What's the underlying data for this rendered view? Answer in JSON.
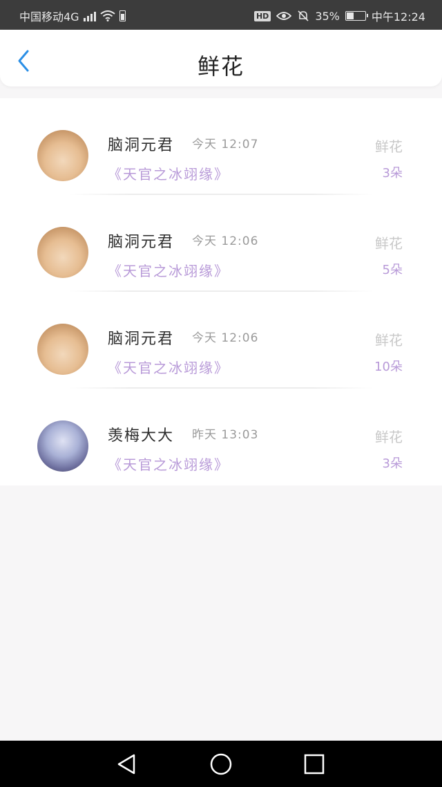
{
  "status_bar": {
    "carrier": "中国移动4G",
    "network": "4G",
    "battery_percent": "35%",
    "battery_level": 0.35,
    "time": "中午12:24",
    "hd_label": "HD"
  },
  "header": {
    "title": "鲜花",
    "back_icon": "chevron-left-icon",
    "accent_color": "#2b8fe6"
  },
  "colors": {
    "book_title": "#b89ad8",
    "gift_label": "#c8c8c8",
    "name": "#2d2d2d",
    "time": "#9a9a9a"
  },
  "records": [
    {
      "name": "脑洞元君",
      "time": "今天 12:07",
      "book": "《天官之冰翊缘》",
      "gift_label": "鲜花",
      "count": "3朵",
      "avatar": "cat"
    },
    {
      "name": "脑洞元君",
      "time": "今天 12:06",
      "book": "《天官之冰翊缘》",
      "gift_label": "鲜花",
      "count": "5朵",
      "avatar": "cat"
    },
    {
      "name": "脑洞元君",
      "time": "今天 12:06",
      "book": "《天官之冰翊缘》",
      "gift_label": "鲜花",
      "count": "10朵",
      "avatar": "cat"
    },
    {
      "name": "羡梅大大",
      "time": "昨天 13:03",
      "book": "《天官之冰翊缘》",
      "gift_label": "鲜花",
      "count": "3朵",
      "avatar": "anime"
    }
  ],
  "nav_bar": {
    "back_icon": "triangle-back-icon",
    "home_icon": "circle-home-icon",
    "recents_icon": "square-recents-icon"
  }
}
